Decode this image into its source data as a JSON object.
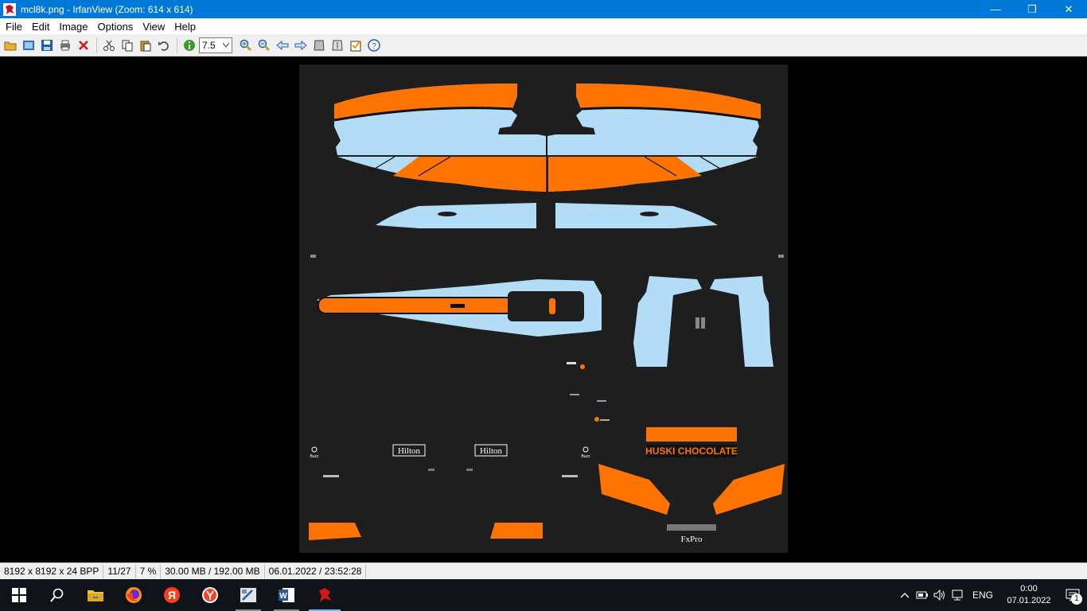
{
  "window": {
    "title": "mcl8k.png - IrfanView (Zoom: 614 x 614)",
    "min_label": "—",
    "max_label": "❐",
    "close_label": "✕"
  },
  "menu": [
    {
      "label": "File"
    },
    {
      "label": "Edit"
    },
    {
      "label": "Image"
    },
    {
      "label": "Options"
    },
    {
      "label": "View"
    },
    {
      "label": "Help"
    }
  ],
  "toolbar": {
    "zoom_value": "7.5",
    "icons": [
      "open-folder-icon",
      "thumbnails-icon",
      "save-icon",
      "print-icon",
      "delete-icon",
      "cut-icon",
      "copy-icon",
      "paste-icon",
      "undo-icon",
      "info-icon",
      "zoom-in-icon",
      "zoom-out-icon",
      "previous-icon",
      "next-icon",
      "first-icon",
      "last-icon",
      "properties-icon",
      "help-icon"
    ]
  },
  "image_labels": {
    "hilton_1": "Hilton",
    "hilton_2": "Hilton",
    "huski": "HUSKI CHOCOLATE",
    "fxpro": "FxPro",
    "buzz_1": "Buzz",
    "buzz_2": "Buzz"
  },
  "status": {
    "dimensions": "8192 x 8192 x 24 BPP",
    "index": "11/27",
    "zoom": "7 %",
    "memory": "30.00 MB / 192.00 MB",
    "datetime": "06.01.2022 / 23:52:28"
  },
  "taskbar": {
    "apps": [
      "start-icon",
      "search-icon",
      "file-explorer-icon",
      "firefox-icon",
      "yandex-ya-icon",
      "yandex-browser-icon",
      "media-app-icon",
      "word-icon",
      "irfanview-icon"
    ],
    "lang": "ENG",
    "time": "0:00",
    "date": "07.01.2022",
    "notifications": "1"
  },
  "colors": {
    "accent": "#0078d7",
    "livery_orange": "#ff7300",
    "livery_blue": "#b3dcf7",
    "canvas_bg": "#1e1e1e"
  }
}
